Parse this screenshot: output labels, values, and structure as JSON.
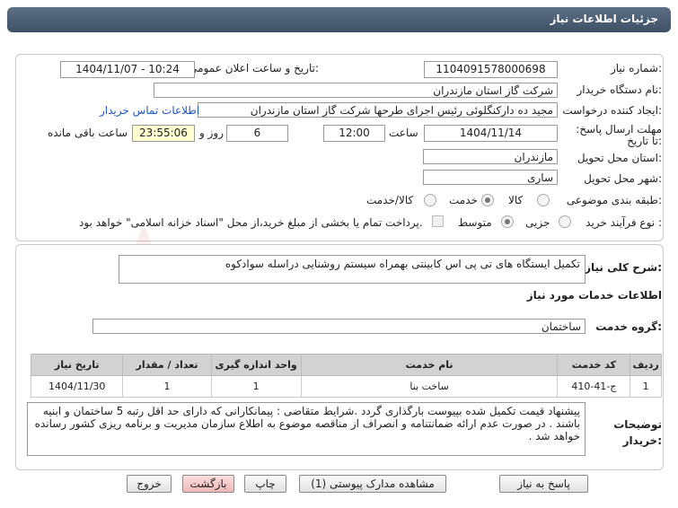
{
  "header": {
    "title": "جزئیات اطلاعات نیاز"
  },
  "fields": {
    "need_number_label": "شماره نیاز:",
    "need_number": "1104091578000698",
    "announce_datetime_label": "تاریخ و ساعت اعلان عمومی:",
    "announce_datetime": "1404/11/07 - 10:24",
    "buyer_org_label": "نام دستگاه خریدار:",
    "buyer_org": "شرکت گاز استان مازندران",
    "creator_label": "ایجاد کننده درخواست:",
    "creator": "مجید ده دارکنگلوئی رئیس اجرای طرحها شرکت گاز استان مازندران",
    "contact_link": "اطلاعات تماس خریدار",
    "deadline_label": "مهلت ارسال پاسخ: تا تاریخ:",
    "deadline_date": "1404/11/14",
    "time_label": "ساعت",
    "deadline_time": "12:00",
    "days_value": "6",
    "days_label": "روز و",
    "remaining_time": "23:55:06",
    "remaining_label": "ساعت باقی مانده",
    "province_label": "استان محل تحویل:",
    "province": "مازندران",
    "city_label": "شهر محل تحویل:",
    "city": "ساری",
    "category_label": "طبقه بندی موضوعی:",
    "category_options": [
      "کالا",
      "خدمت",
      "کالا/خدمت"
    ],
    "category_selected": "خدمت",
    "process_label": "نوع فرآیند خرید :",
    "process_options": [
      "جزیی",
      "متوسط"
    ],
    "process_selected": "متوسط",
    "payment_note": "پرداخت تمام یا بخشی از مبلغ خرید،از محل \"اسناد خزانه اسلامی\" خواهد بود."
  },
  "summary": {
    "label": "شرح کلی نیاز:",
    "text": "تکمیل ایستگاه های تی پی اس کابینتی بهمراه سیستم روشنایی دراسله سوادکوه"
  },
  "services": {
    "section_title": "اطلاعات خدمات مورد نیاز",
    "group_label": "گروه خدمت:",
    "group_value": "ساختمان",
    "columns": [
      "ردیف",
      "کد خدمت",
      "نام خدمت",
      "واحد اندازه گیری",
      "تعداد / مقدار",
      "تاریخ نیاز"
    ],
    "rows": [
      [
        "1",
        "ج-41-410",
        "ساخت بنا",
        "1",
        "1",
        "1404/11/30"
      ]
    ]
  },
  "notes": {
    "label": "توضیحات خریدار:",
    "text": "پیشنهاد قیمت تکمیل شده بپیوست  بارگذاری گردد .شرایط متقاضی : پیمانکارانی که دارای حد اقل رتبه 5 ساختمان و ابنیه باشند . در صورت عدم ارائه ضمانتنامه و انصراف از مناقصه موضوع به اطلاع سازمان مدیریت و برنامه ریزی کشور رسانده خواهد شد ."
  },
  "buttons": {
    "reply": "پاسخ به نیاز",
    "view_docs": "مشاهده مدارک پیوستی (1)",
    "print": "چاپ",
    "back": "بازگشت",
    "exit": "خروج"
  },
  "watermark": "AriaTender.net",
  "colors": {
    "header_bg": "#4a5d73",
    "link": "#1f56c8",
    "table_header": "#d2d2d2"
  }
}
